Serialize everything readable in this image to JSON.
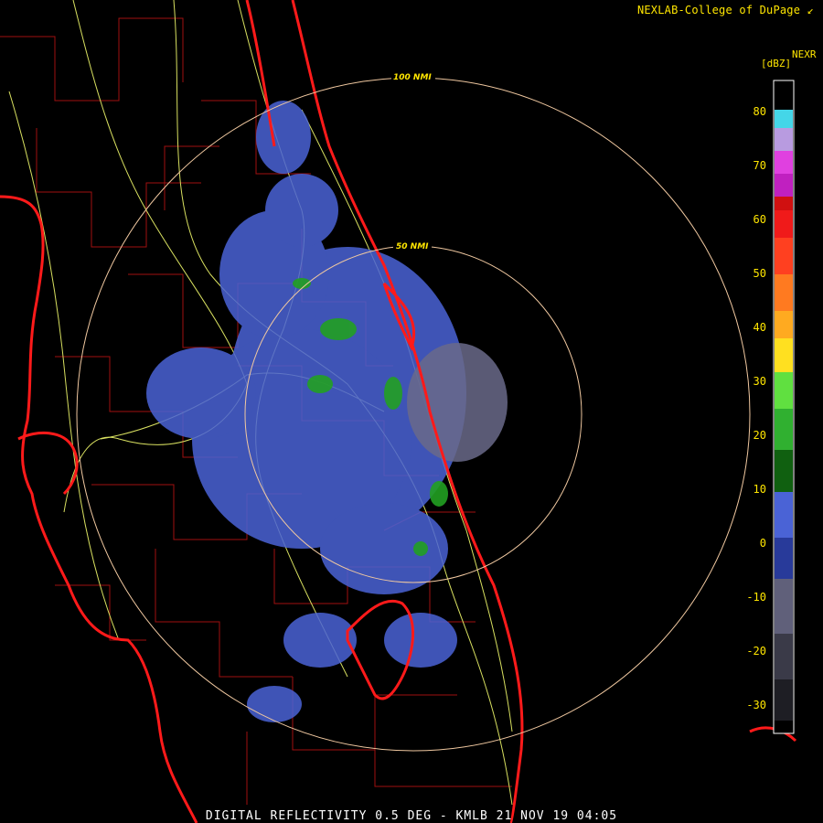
{
  "credit": "NEXLAB-College of DuPage ↙",
  "caption": "DIGITAL REFLECTIVITY 0.5 DEG - KMLB 21 NOV 19 04:05",
  "rings": [
    {
      "label": "50 NMI"
    },
    {
      "label": "100 NMI"
    }
  ],
  "scale": {
    "title": "NEXR",
    "unit": "[dBZ]",
    "ticks": [
      "80",
      "70",
      "60",
      "50",
      "40",
      "30",
      "20",
      "10",
      "0",
      "-10",
      "-20",
      "-30"
    ]
  },
  "colors": {
    "coast": "#ff1a1a",
    "county": "#a01010",
    "road": "#d8e060",
    "ring": "#f0c8a0",
    "echo_weak": "#4a63d6",
    "echo_strong": "#22a022",
    "echo_gray": "#6a6a8a"
  }
}
